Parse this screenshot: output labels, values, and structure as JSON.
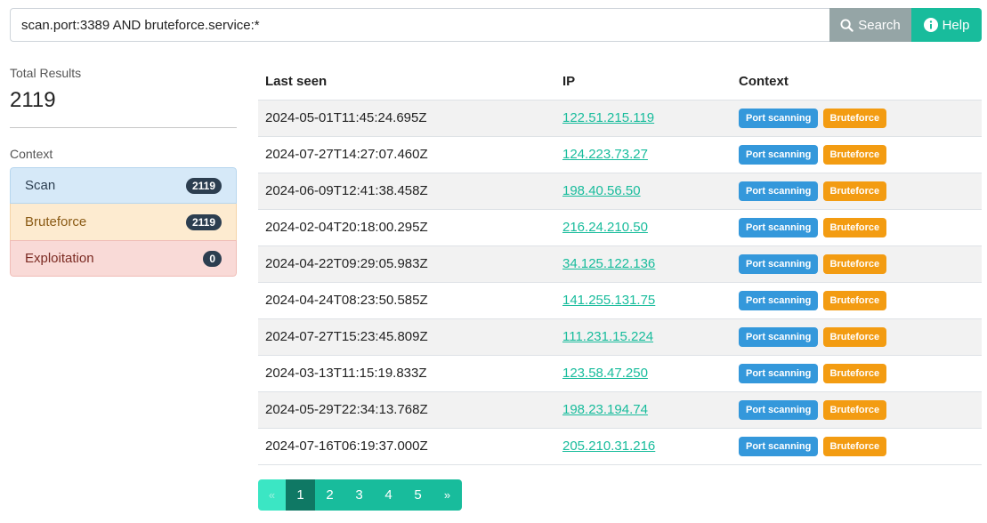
{
  "search": {
    "query": "scan.port:3389 AND bruteforce.service:*",
    "search_label": "Search",
    "help_label": "Help",
    "search_icon": "search-icon",
    "help_icon": "info-circle-icon"
  },
  "summary": {
    "total_label": "Total Results",
    "total_value": "2119",
    "context_label": "Context",
    "contexts": [
      {
        "label": "Scan",
        "count": "2119"
      },
      {
        "label": "Bruteforce",
        "count": "2119"
      },
      {
        "label": "Exploitation",
        "count": "0"
      }
    ]
  },
  "table": {
    "headers": [
      "Last seen",
      "IP",
      "Context"
    ],
    "tag_labels": {
      "scan": "Port scanning",
      "brute": "Bruteforce"
    },
    "rows": [
      {
        "time": "2024-05-01T11:45:24.695Z",
        "ip": "122.51.215.119"
      },
      {
        "time": "2024-07-27T14:27:07.460Z",
        "ip": "124.223.73.27"
      },
      {
        "time": "2024-06-09T12:41:38.458Z",
        "ip": "198.40.56.50"
      },
      {
        "time": "2024-02-04T20:18:00.295Z",
        "ip": "216.24.210.50"
      },
      {
        "time": "2024-04-22T09:29:05.983Z",
        "ip": "34.125.122.136"
      },
      {
        "time": "2024-04-24T08:23:50.585Z",
        "ip": "141.255.131.75"
      },
      {
        "time": "2024-07-27T15:23:45.809Z",
        "ip": "111.231.15.224"
      },
      {
        "time": "2024-03-13T11:15:19.833Z",
        "ip": "123.58.47.250"
      },
      {
        "time": "2024-05-29T22:34:13.768Z",
        "ip": "198.23.194.74"
      },
      {
        "time": "2024-07-16T06:19:37.000Z",
        "ip": "205.210.31.216"
      }
    ]
  },
  "pagination": {
    "prev": "«",
    "pages": [
      "1",
      "2",
      "3",
      "4",
      "5"
    ],
    "current": "1",
    "next": "»"
  },
  "colors": {
    "accent": "#18bc9c",
    "search_button": "#95a5a6",
    "scan_tag": "#3498db",
    "brute_tag": "#f39c12",
    "badge": "#2c3e50"
  }
}
